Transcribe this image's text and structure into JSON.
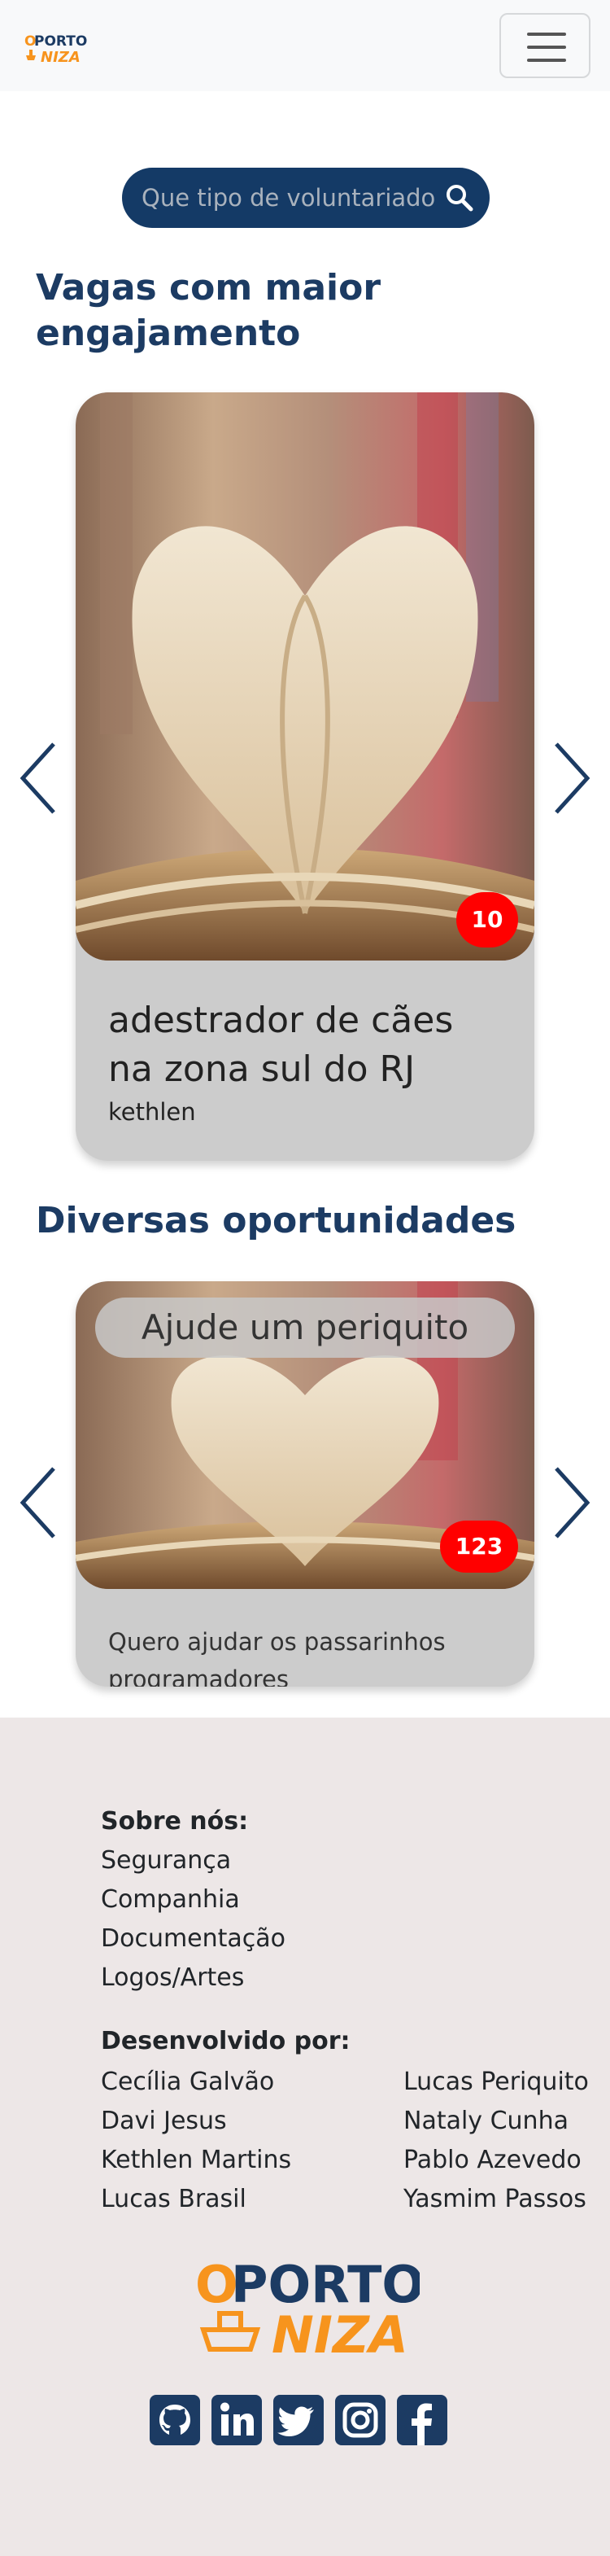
{
  "header": {
    "logo_top": "OPORTO",
    "logo_bottom": "NIZA",
    "menu_icon": "hamburger-menu-icon"
  },
  "search": {
    "placeholder": "Que tipo de voluntariado",
    "icon": "search-icon"
  },
  "engagement": {
    "title": "Vagas com maior engajamento",
    "title_line1": "Vagas com maior",
    "title_line2": "engajamento",
    "card": {
      "count": "10",
      "title_line1": "adestrador de cães",
      "title_line2": "na zona sul do RJ",
      "author": "kethlen"
    }
  },
  "opportunities": {
    "title": "Diversas oportunidades",
    "card": {
      "title": "Ajude um periquito",
      "count": "123",
      "desc_line1": "Quero ajudar os passarinhos",
      "desc_line2": "programadores"
    }
  },
  "footer": {
    "about_title": "Sobre nós:",
    "about_links": [
      "Segurança",
      "Companhia",
      "Documentação",
      "Logos/Artes"
    ],
    "dev_title": "Desenvolvido por:",
    "devs_left": [
      "Cecília Galvão",
      "Davi Jesus",
      "Kethlen Martins",
      "Lucas Brasil"
    ],
    "devs_right": [
      "Lucas Periquito",
      "Nataly Cunha",
      "Pablo Azevedo",
      "Yasmim Passos"
    ],
    "logo_top": "OPORTO",
    "logo_bottom": "NIZA",
    "social_icons": [
      "github-icon",
      "linkedin-icon",
      "twitter-icon",
      "instagram-icon",
      "facebook-icon"
    ]
  },
  "colors": {
    "brand_navy": "#1c3b63",
    "brand_orange": "#f7941d",
    "badge_red": "#ff0000",
    "card_gray": "#cccccc",
    "footer_bg": "#ede7e7"
  }
}
